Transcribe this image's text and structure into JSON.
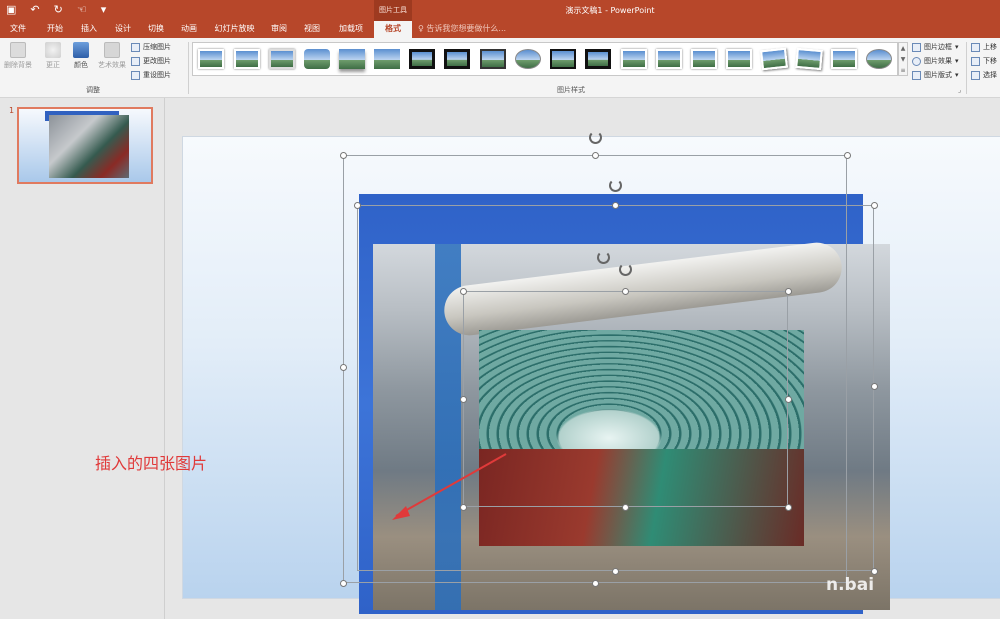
{
  "app": {
    "window_title": "演示文稿1 - PowerPoint",
    "context_group": "图片工具",
    "qat_icons": [
      "save-icon",
      "undo-icon",
      "redo-icon",
      "touch-mode-icon",
      "customize-icon"
    ]
  },
  "tabs": [
    {
      "label": "文件"
    },
    {
      "label": "开始"
    },
    {
      "label": "插入"
    },
    {
      "label": "设计"
    },
    {
      "label": "切换"
    },
    {
      "label": "动画"
    },
    {
      "label": "幻灯片放映"
    },
    {
      "label": "审阅"
    },
    {
      "label": "视图"
    },
    {
      "label": "加载项"
    },
    {
      "label": "格式",
      "active": true
    }
  ],
  "tell_me": "告诉我您想要做什么...",
  "ribbon": {
    "adjust": {
      "remove_bg": "删除背景",
      "corrections": "更正",
      "color": "颜色",
      "artistic": "艺术效果",
      "compress": "压缩图片",
      "change": "更改图片",
      "reset": "重设图片",
      "group_label": "调整"
    },
    "styles": {
      "group_label": "图片样式",
      "border": "图片边框",
      "effects": "图片效果",
      "layout": "图片版式"
    },
    "arrange": {
      "bring_forward": "上移",
      "send_backward": "下移",
      "select": "选择"
    }
  },
  "slides": [
    {
      "number": "1"
    }
  ],
  "canvas": {
    "annotation": "插入的四张图片",
    "watermark": "n.bai"
  },
  "colors": {
    "accent": "#b7472a",
    "annotation": "#e03a3a"
  }
}
